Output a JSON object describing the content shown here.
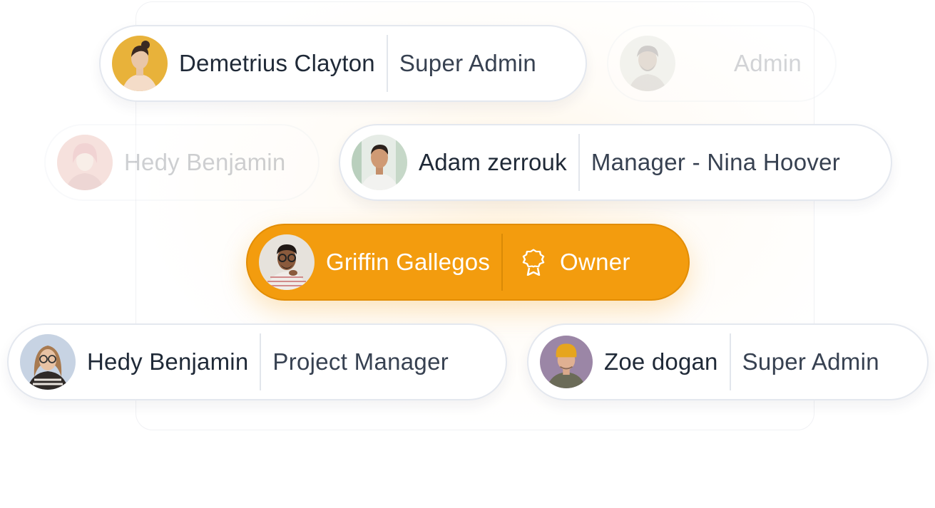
{
  "members": [
    {
      "name": "Demetrius Clayton",
      "role": "Super Admin",
      "avatar_color": "#e8b23a"
    },
    {
      "name": "",
      "role": "Admin",
      "avatar_color": "#c9cfc4"
    },
    {
      "name": "Hedy Benjamin",
      "role": "",
      "avatar_color": "#d97a6a"
    },
    {
      "name": "Adam zerrouk",
      "role": "Manager - Nina Hoover",
      "avatar_color": "#cfe0d2"
    },
    {
      "name": "Griffin Gallegos",
      "role": "Owner",
      "avatar_color": "#e6e2dc",
      "badge_icon": "award-ribbon-icon"
    },
    {
      "name": "Hedy Benjamin",
      "role": "Project Manager",
      "avatar_color": "#c7d3e3"
    },
    {
      "name": "Zoe dogan",
      "role": "Super Admin",
      "avatar_color": "#9b86a6"
    }
  ],
  "colors": {
    "owner_accent": "#f39c0e",
    "text_dark": "#1f2937",
    "text_muted": "#374151",
    "border": "#e4e8ef"
  }
}
